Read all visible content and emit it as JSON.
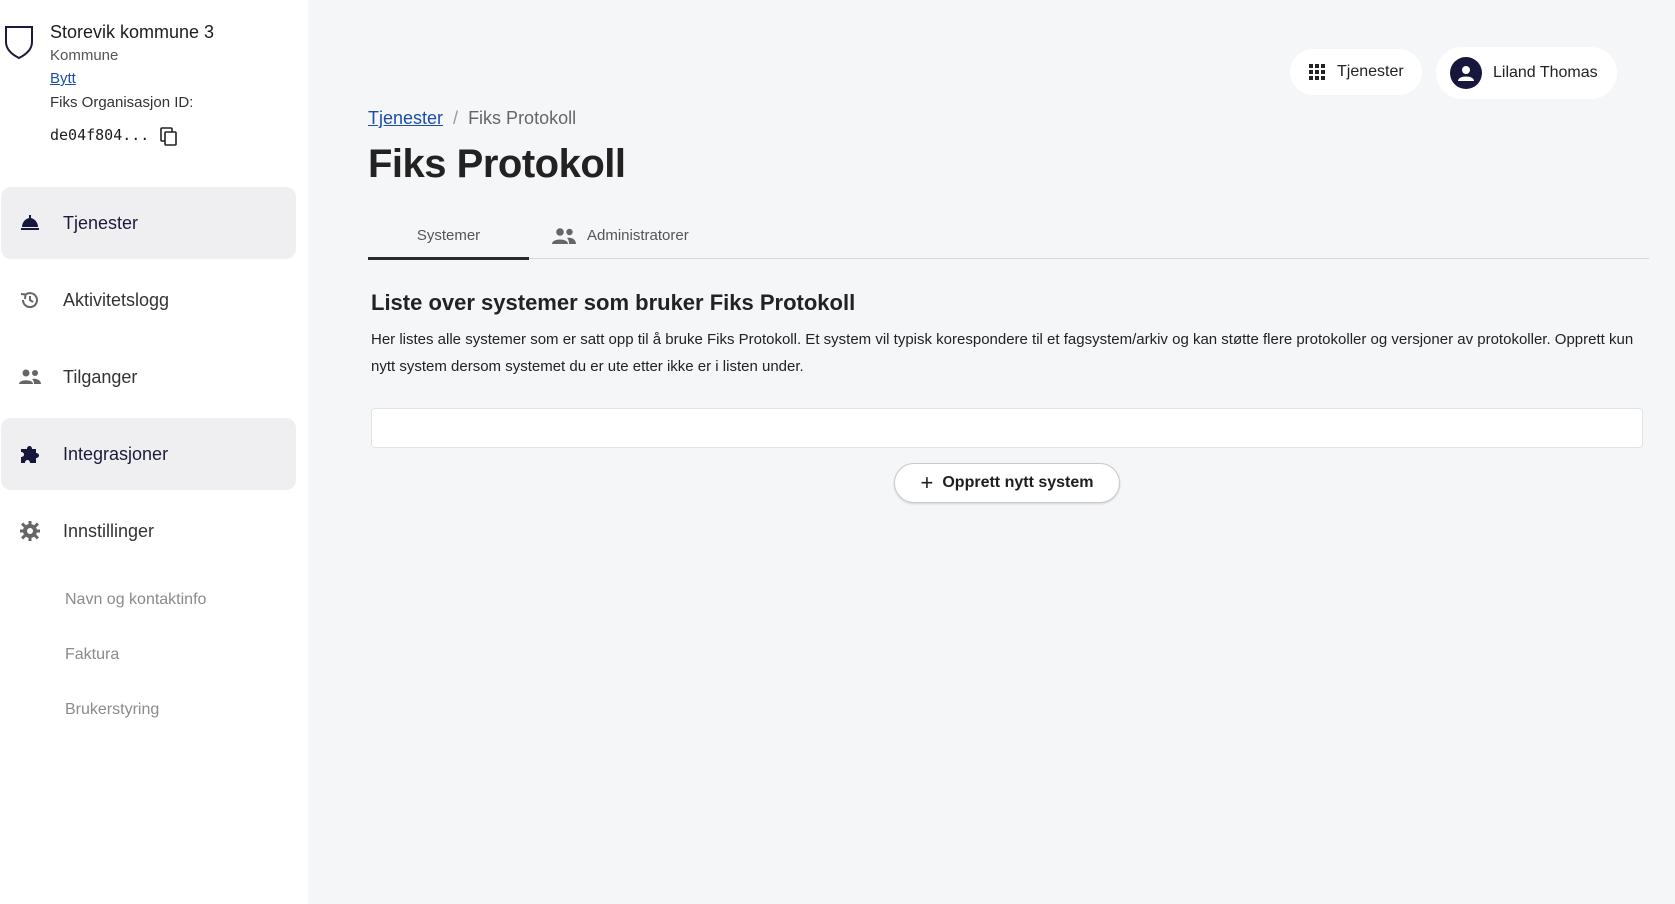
{
  "org": {
    "name": "Storevik kommune 3",
    "type": "Kommune",
    "switch_label": "Bytt",
    "id_label": "Fiks Organisasjon ID:",
    "id_value": "de04f804..."
  },
  "sidebar": {
    "items": [
      {
        "label": "Tjenester",
        "icon": "cloche-icon",
        "active": true
      },
      {
        "label": "Aktivitetslogg",
        "icon": "history-icon",
        "active": false
      },
      {
        "label": "Tilganger",
        "icon": "people-icon",
        "active": false
      },
      {
        "label": "Integrasjoner",
        "icon": "puzzle-icon",
        "active": true
      },
      {
        "label": "Innstillinger",
        "icon": "gear-icon",
        "active": false
      }
    ],
    "sub_items": [
      "Navn og kontaktinfo",
      "Faktura",
      "Brukerstyring"
    ]
  },
  "header": {
    "services_button": "Tjenester",
    "user_name": "Liland Thomas"
  },
  "breadcrumb": {
    "link": "Tjenester",
    "separator": "/",
    "current": "Fiks Protokoll"
  },
  "page": {
    "title": "Fiks Protokoll",
    "tabs": [
      {
        "label": "Systemer",
        "active": true
      },
      {
        "label": "Administratorer",
        "icon": "people-icon",
        "active": false
      }
    ],
    "section_title": "Liste over systemer som bruker Fiks Protokoll",
    "section_desc": "Her listes alle systemer som er satt opp til å bruke Fiks Protokoll. Et system vil typisk korespondere til et fagsystem/arkiv og kan støtte flere protokoller og versjoner av protokoller. Opprett kun nytt system dersom systemet du er ute etter ikke er i listen under.",
    "create_button": "Opprett nytt system"
  },
  "colors": {
    "accent": "#17173d",
    "link": "#1a4ea8",
    "background": "#f5f6f8",
    "sidebar_active": "#efeff2"
  }
}
